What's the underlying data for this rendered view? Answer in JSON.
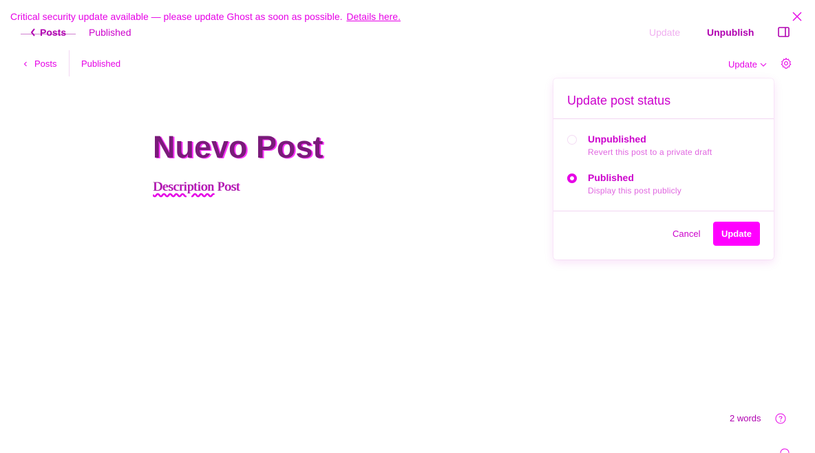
{
  "banner": {
    "text": "Critical security update available — please update Ghost as soon as possible.",
    "link": "Details here."
  },
  "top_header": {
    "back_label": "Posts",
    "status": "Published",
    "update_label": "Update",
    "unpublish_label": "Unpublish"
  },
  "sub_header": {
    "back_label": "Posts",
    "status": "Published",
    "update_label": "Update"
  },
  "editor": {
    "title": "Nuevo Post",
    "description_word1": "Description",
    "description_word2": "Post"
  },
  "popover": {
    "title": "Update post status",
    "options": [
      {
        "label": "Unpublished",
        "description": "Revert this post to a private draft",
        "selected": false
      },
      {
        "label": "Published",
        "description": "Display this post publicly",
        "selected": true
      }
    ],
    "cancel_label": "Cancel",
    "update_label": "Update"
  },
  "footer": {
    "word_count": "2 words"
  },
  "colors": {
    "accent": "#ff00ff",
    "text": "#cc00cc",
    "title": "#7a1b7a"
  },
  "icons": [
    "close-icon",
    "chevron-left-icon",
    "sidebar-toggle-icon",
    "chevron-down-icon",
    "gear-icon",
    "radio-icon",
    "help-icon"
  ]
}
